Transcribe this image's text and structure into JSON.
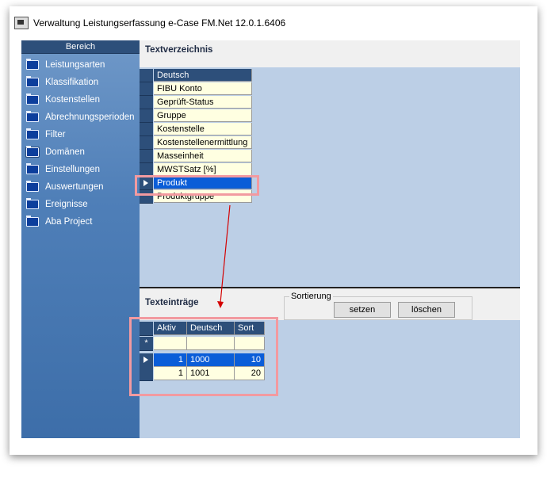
{
  "window": {
    "title": "Verwaltung Leistungserfassung e-Case FM.Net 12.0.1.6406"
  },
  "sidebar": {
    "header": "Bereich",
    "items": [
      {
        "label": "Leistungsarten"
      },
      {
        "label": "Klassifikation"
      },
      {
        "label": "Kostenstellen"
      },
      {
        "label": "Abrechnungsperioden"
      },
      {
        "label": "Filter"
      },
      {
        "label": "Domänen"
      },
      {
        "label": "Einstellungen"
      },
      {
        "label": "Auswertungen"
      },
      {
        "label": "Ereignisse"
      },
      {
        "label": "Aba Project"
      }
    ],
    "selected": "Domänen"
  },
  "textverzeichnis": {
    "title": "Textverzeichnis",
    "column_header": "Deutsch",
    "rows": [
      "FIBU Konto",
      "Geprüft-Status",
      "Gruppe",
      "Kostenstelle",
      "Kostenstellenermittlung",
      "Masseinheit",
      "MWSTSatz [%]",
      "Produkt",
      "Produktgruppe"
    ],
    "selected_row": "Produkt"
  },
  "texteintraege": {
    "title": "Texteinträge",
    "sortierung": {
      "label": "Sortierung",
      "set_button": "setzen",
      "delete_button": "löschen"
    },
    "columns": [
      "Aktiv",
      "Deutsch",
      "Sort"
    ],
    "new_row_marker": "*",
    "rows": [
      {
        "aktiv": "1",
        "deutsch": "1000",
        "sort": "10",
        "selected": true
      },
      {
        "aktiv": "1",
        "deutsch": "1001",
        "sort": "20",
        "selected": false
      }
    ]
  },
  "colors": {
    "sidebar": "#4f7fb8",
    "grid_header": "#2d4f7a",
    "selection": "#0a5dd8",
    "highlight": "#f29aa0",
    "annotation_arrow": "#d40000"
  }
}
